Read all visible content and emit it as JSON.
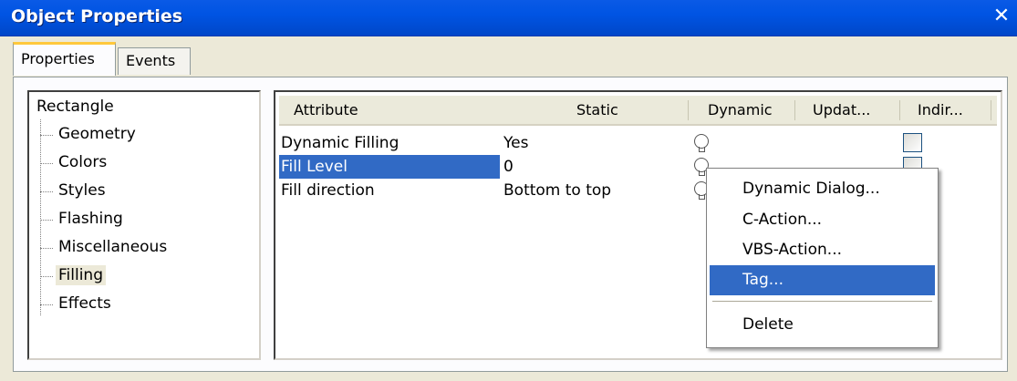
{
  "window": {
    "title": "Object Properties",
    "close_glyph": "✕"
  },
  "tabs": [
    {
      "label": "Properties",
      "active": true
    },
    {
      "label": "Events",
      "active": false
    }
  ],
  "tree": {
    "root": "Rectangle",
    "items": [
      "Geometry",
      "Colors",
      "Styles",
      "Flashing",
      "Miscellaneous",
      "Filling",
      "Effects"
    ],
    "selected": "Filling"
  },
  "grid": {
    "columns": [
      "Attribute",
      "Static",
      "Dynamic",
      "Updat...",
      "Indir..."
    ],
    "rows": [
      {
        "attribute": "Dynamic Filling",
        "static": "Yes"
      },
      {
        "attribute": "Fill Level",
        "static": "0",
        "selected": true
      },
      {
        "attribute": "Fill direction",
        "static": "Bottom to top"
      }
    ]
  },
  "context_menu": {
    "items": [
      "Dynamic Dialog...",
      "C-Action...",
      "VBS-Action...",
      "Tag...",
      "Delete"
    ],
    "highlighted": "Tag..."
  },
  "colors": {
    "titlebar": "#0054e3",
    "selection": "#316ac5",
    "tab_accent": "#ffc83c"
  },
  "icons": [
    "close-icon",
    "lightbulb-icon",
    "checkbox"
  ]
}
